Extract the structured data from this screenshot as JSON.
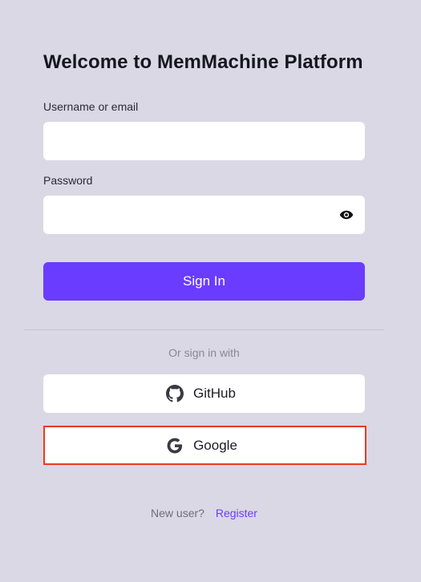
{
  "page": {
    "title": "Welcome to MemMachine Platform"
  },
  "form": {
    "username_label": "Username or email",
    "username_value": "",
    "username_placeholder": "",
    "password_label": "Password",
    "password_value": "",
    "password_placeholder": "",
    "password_toggle_icon": "eye-icon",
    "signin_label": "Sign In"
  },
  "social": {
    "divider_text": "Or sign in with",
    "github_label": "GitHub",
    "github_icon": "github-icon",
    "google_label": "Google",
    "google_icon": "google-icon"
  },
  "footer": {
    "new_user_text": "New user?",
    "register_label": "Register"
  },
  "colors": {
    "background": "#dad8e4",
    "accent": "#6a3cff",
    "highlight_border": "#ea3a1e"
  }
}
